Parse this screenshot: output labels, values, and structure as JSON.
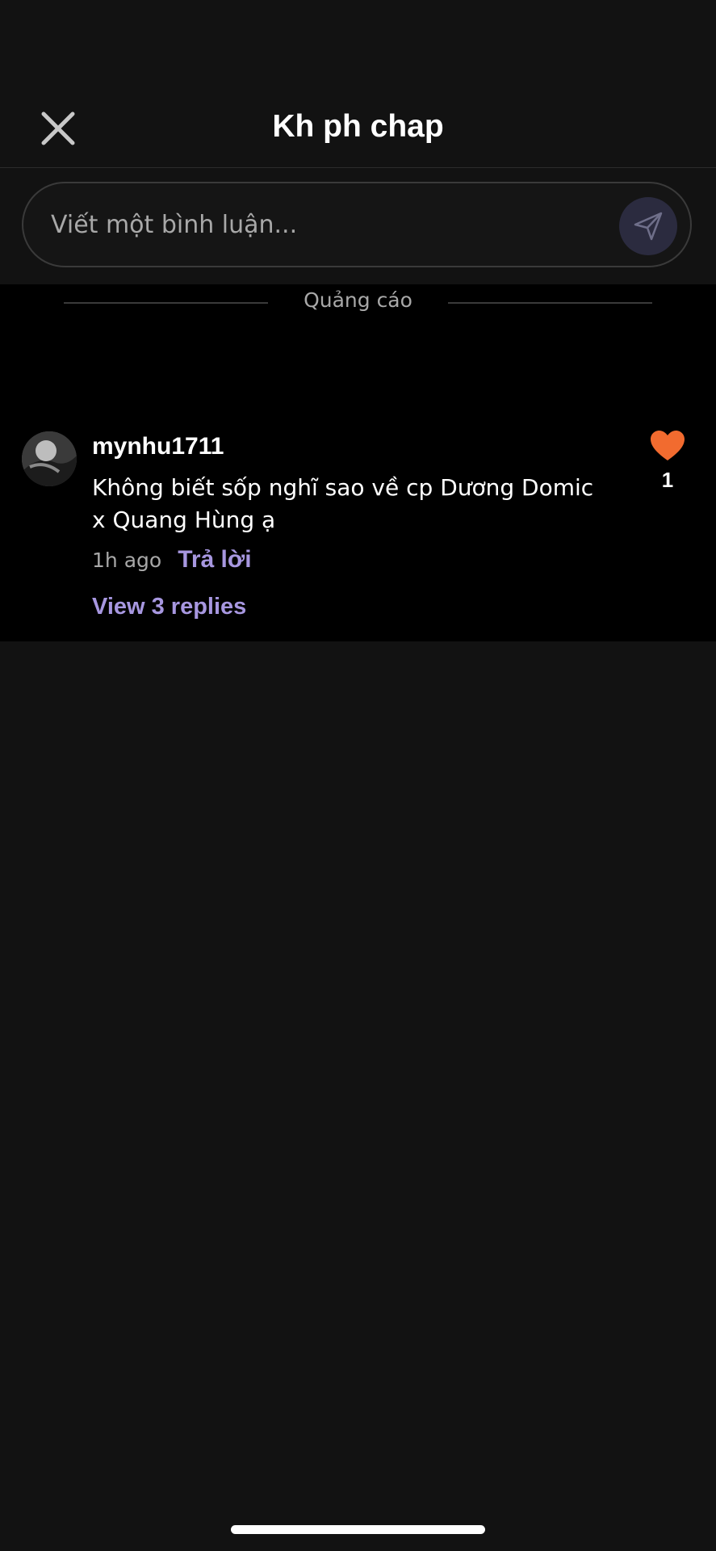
{
  "header": {
    "title": "Kh ph chap",
    "close_icon": "close-icon"
  },
  "comment_input": {
    "placeholder": "Viết một bình luận...",
    "send_icon": "send-icon"
  },
  "ad": {
    "label": "Quảng cáo"
  },
  "comments": [
    {
      "username": "mynhu1711",
      "text": "Không biết sốp nghĩ sao về cp Dương Domic x Quang Hùng ạ",
      "time": "1h ago",
      "reply_label": "Trả lời",
      "view_replies_label": "View 3 replies",
      "like_count": "1",
      "like_icon": "heart-icon"
    }
  ],
  "colors": {
    "background": "#121212",
    "content_background": "#000000",
    "accent": "#a797e0",
    "like": "#f26b2f",
    "send_button": "#2b2b3f"
  }
}
